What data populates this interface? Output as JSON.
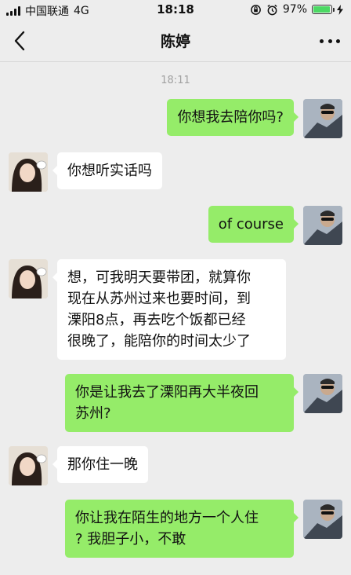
{
  "status_bar": {
    "carrier": "中国联通",
    "network": "4G",
    "time": "18:18",
    "battery_percent": "97%",
    "battery_level": 0.97,
    "battery_color": "#4cd964"
  },
  "nav": {
    "title": "陈婷",
    "back_icon": "chevron-left-icon",
    "more_icon": "more-dots-icon"
  },
  "chat": {
    "timestamp": "18:11",
    "messages": [
      {
        "from": "me",
        "text": "你想我去陪你吗?"
      },
      {
        "from": "her",
        "text": "你想听实话吗"
      },
      {
        "from": "me",
        "text": "of course"
      },
      {
        "from": "her",
        "lines": [
          "想，可我明天要带团，就算你",
          "现在从苏州过来也要时间，到",
          "溧阳8点，再去吃个饭都已经",
          "很晚了，能陪你的时间太少了"
        ]
      },
      {
        "from": "me",
        "lines": [
          "你是让我去了溧阳再大半夜回",
          "苏州?"
        ]
      },
      {
        "from": "her",
        "text": "那你住一晚"
      },
      {
        "from": "me",
        "lines": [
          "你让我在陌生的地方一个人住",
          "? 我胆子小，不敢"
        ]
      }
    ]
  },
  "colors": {
    "sent_bubble": "#95ec69",
    "received_bubble": "#ffffff",
    "background": "#ededed"
  }
}
